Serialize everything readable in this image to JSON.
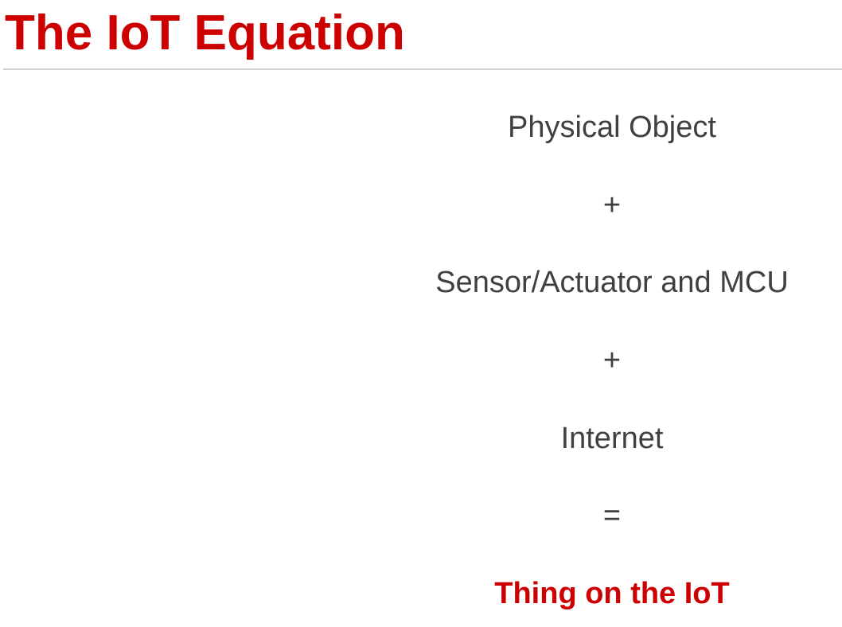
{
  "slide": {
    "title": "The IoT Equation",
    "equation": {
      "term_1": "Physical Object",
      "operator_1": "+",
      "term_2": "Sensor/Actuator and MCU",
      "operator_2": "+",
      "term_3": "Internet",
      "operator_3": "=",
      "result": "Thing on the IoT"
    },
    "colors": {
      "title": "#cc0000",
      "body_text": "#404040",
      "result": "#cc0000",
      "rule": "#d0d0d0"
    }
  }
}
